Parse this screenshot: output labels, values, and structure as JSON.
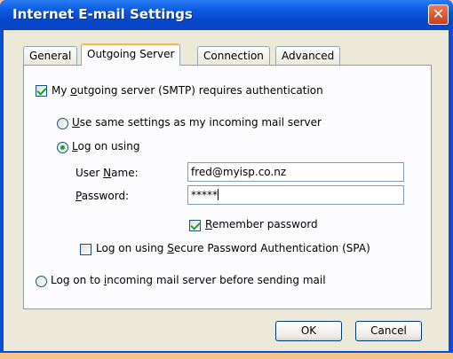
{
  "window": {
    "title": "Internet E-mail Settings",
    "close_glyph": "✕"
  },
  "tabs": [
    {
      "label": "General"
    },
    {
      "label": "Outgoing Server"
    },
    {
      "label": "Connection"
    },
    {
      "label": "Advanced"
    }
  ],
  "smtp_auth": {
    "label_pre": "My ",
    "label_u": "o",
    "label_post": "utgoing server (SMTP) requires authentication",
    "checked": true
  },
  "use_same": {
    "label_u": "U",
    "label_post": "se same settings as my incoming mail server",
    "selected": false
  },
  "log_on_using": {
    "label_u": "L",
    "label_post": "og on using",
    "selected": true
  },
  "username": {
    "label_pre": "User ",
    "label_u": "N",
    "label_post": "ame:",
    "value": "fred@myisp.co.nz"
  },
  "password": {
    "label_u": "P",
    "label_post": "assword:",
    "value": "*****"
  },
  "remember": {
    "label_u": "R",
    "label_post": "emember password",
    "checked": true
  },
  "spa": {
    "label_pre": "Log on using ",
    "label_u": "S",
    "label_post": "ecure Password Authentication (SPA)",
    "checked": false
  },
  "log_on_incoming": {
    "label_pre": "Log on to ",
    "label_u": "i",
    "label_post": "ncoming mail server before sending mail",
    "selected": false
  },
  "buttons": {
    "ok": "OK",
    "cancel": "Cancel"
  }
}
